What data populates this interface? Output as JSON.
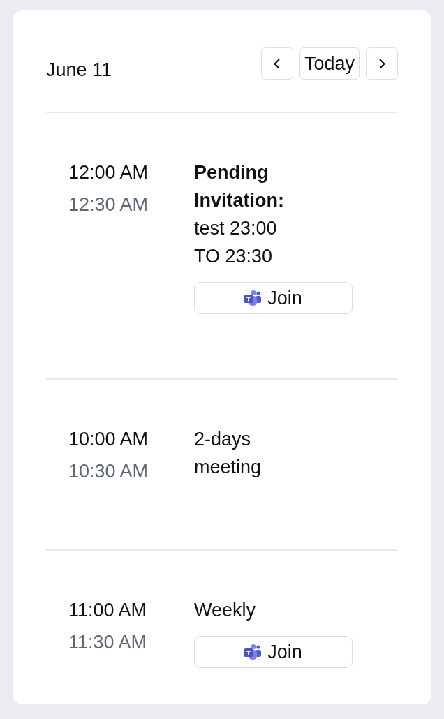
{
  "header": {
    "date": "June 11",
    "today_button": "Today"
  },
  "events": [
    {
      "start": "12:00 AM",
      "end": "12:30 AM",
      "title": "**Pending Invitation:** test 23:00 TO 23:30",
      "join_button": "Join"
    },
    {
      "start": "10:00 AM",
      "end": "10:30 AM",
      "title": "2-days meeting"
    },
    {
      "start": "11:00 AM",
      "end": "11:30 AM",
      "title": "Weekly",
      "join_button": "Join"
    }
  ]
}
